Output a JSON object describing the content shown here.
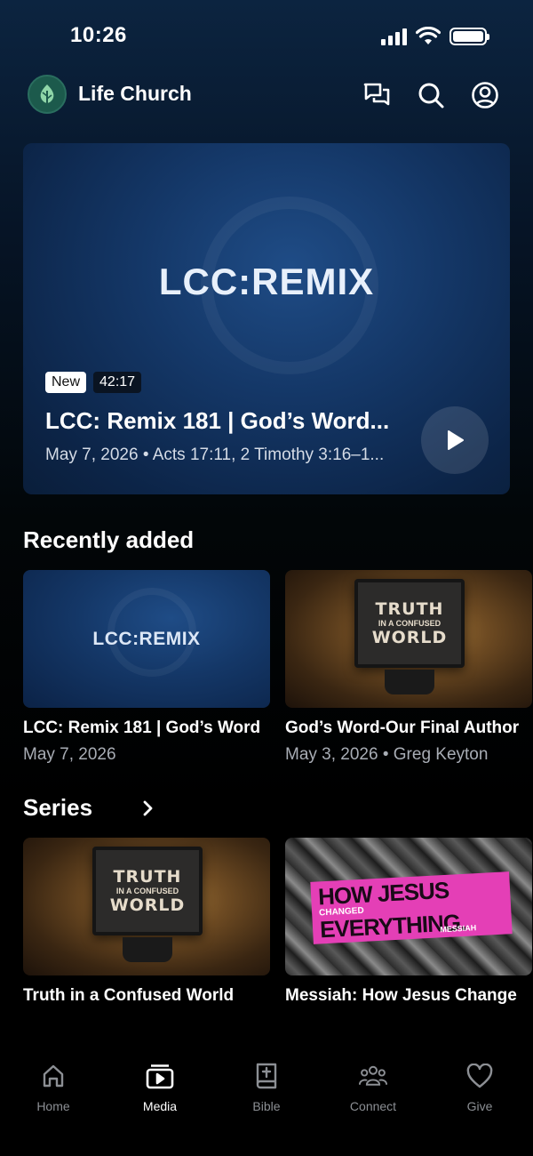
{
  "status_bar": {
    "time": "10:26"
  },
  "header": {
    "app_title": "Life Church"
  },
  "hero": {
    "logo_text": "LCC:REMIX",
    "badge_new": "New",
    "duration": "42:17",
    "title": "LCC: Remix 181 | God’s Word...",
    "meta": "May 7, 2026 • Acts 17:11, 2 Timothy 3:16–1..."
  },
  "recently_added": {
    "title": "Recently added",
    "items": [
      {
        "thumb_text": "LCC:REMIX",
        "title": "LCC: Remix 181 | God’s Word",
        "subtitle": "May 7, 2026"
      },
      {
        "thumb_line1": "TRUTH",
        "thumb_line2": "IN A CONFUSED",
        "thumb_line3": "WORLD",
        "title": "God’s Word-Our Final Author",
        "subtitle": "May 3, 2026 • Greg Keyton"
      }
    ]
  },
  "series": {
    "title": "Series",
    "items": [
      {
        "thumb_line1": "TRUTH",
        "thumb_line2": "IN A CONFUSED",
        "thumb_line3": "WORLD",
        "title": "Truth in a Confused World"
      },
      {
        "thumb_how": "HOW",
        "thumb_changed": "CHANGED",
        "thumb_jesus": "JESUS",
        "thumb_everything": "EVERYTHING.",
        "thumb_messiah": "MESSIAH",
        "title": "Messiah: How Jesus Change"
      }
    ]
  },
  "tab_bar": {
    "tabs": [
      {
        "label": "Home",
        "icon": "home-icon"
      },
      {
        "label": "Media",
        "icon": "media-icon"
      },
      {
        "label": "Bible",
        "icon": "bible-icon"
      },
      {
        "label": "Connect",
        "icon": "connect-icon"
      },
      {
        "label": "Give",
        "icon": "heart-icon"
      }
    ],
    "active": "Media"
  },
  "colors": {
    "background_top": "#0c2440",
    "background_bottom": "#000000",
    "accent_logo": "#1c5a4c",
    "inactive_tab": "#8c8f94"
  }
}
